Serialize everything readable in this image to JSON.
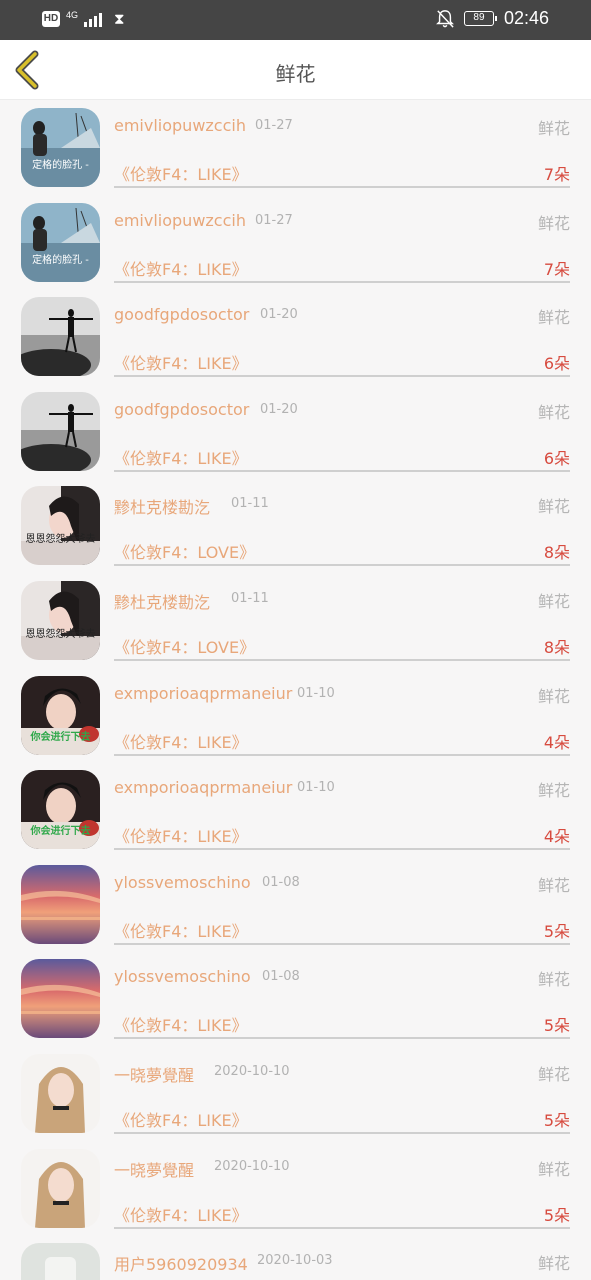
{
  "status_bar": {
    "hd": "HD",
    "network": "4G",
    "battery": "89",
    "time": "02:46"
  },
  "header": {
    "title": "鲜花"
  },
  "records": [
    {
      "user": "emivliopuwzccih",
      "date": "01-27",
      "kind": "鲜花",
      "song": "《伦敦F4：LIKE》",
      "count": "7朵",
      "avatar_caption": "定格的脸孔 -"
    },
    {
      "user": "emivliopuwzccih",
      "date": "01-27",
      "kind": "鲜花",
      "song": "《伦敦F4：LIKE》",
      "count": "7朵",
      "avatar_caption": "定格的脸孔 -"
    },
    {
      "user": "goodfgpdosoctor",
      "date": "01-20",
      "kind": "鲜花",
      "song": "《伦敦F4：LIKE》",
      "count": "6朵",
      "avatar_caption": ""
    },
    {
      "user": "goodfgpdosoctor",
      "date": "01-20",
      "kind": "鲜花",
      "song": "《伦敦F4：LIKE》",
      "count": "6朵",
      "avatar_caption": ""
    },
    {
      "user": "黪杜克楼勘汔",
      "date": "01-11",
      "kind": "鲜花",
      "song": "《伦敦F4：LOVE》",
      "count": "8朵",
      "avatar_caption": "恩恩怨怨大爷去"
    },
    {
      "user": "黪杜克楼勘汔",
      "date": "01-11",
      "kind": "鲜花",
      "song": "《伦敦F4：LOVE》",
      "count": "8朵",
      "avatar_caption": "恩恩怨怨大爷去"
    },
    {
      "user": "exmporioaqprmaneiur",
      "date": "01-10",
      "kind": "鲜花",
      "song": "《伦敦F4：LIKE》",
      "count": "4朵",
      "avatar_caption": "你会进行下去"
    },
    {
      "user": "exmporioaqprmaneiur",
      "date": "01-10",
      "kind": "鲜花",
      "song": "《伦敦F4：LIKE》",
      "count": "4朵",
      "avatar_caption": "你会进行下去"
    },
    {
      "user": "ylossvemoschino",
      "date": "01-08",
      "kind": "鲜花",
      "song": "《伦敦F4：LIKE》",
      "count": "5朵",
      "avatar_caption": ""
    },
    {
      "user": "ylossvemoschino",
      "date": "01-08",
      "kind": "鲜花",
      "song": "《伦敦F4：LIKE》",
      "count": "5朵",
      "avatar_caption": ""
    },
    {
      "user": "一晓夢覺醒",
      "date": "2020-10-10",
      "kind": "鲜花",
      "song": "《伦敦F4：LIKE》",
      "count": "5朵",
      "avatar_caption": ""
    },
    {
      "user": "一晓夢覺醒",
      "date": "2020-10-10",
      "kind": "鲜花",
      "song": "《伦敦F4：LIKE》",
      "count": "5朵",
      "avatar_caption": ""
    },
    {
      "user": "用户5960920934",
      "date": "2020-10-03",
      "kind": "鲜花",
      "song": "",
      "count": "",
      "avatar_caption": ""
    }
  ],
  "colors": {
    "accent": "#e8a77a",
    "count": "#d74b3f",
    "muted": "#b2b2b2",
    "back_icon": "#d8c02b"
  },
  "icons": {
    "back": "chevron-left-icon",
    "signal": "signal-bars-icon",
    "hourglass": "hourglass-icon",
    "bell_off": "bell-off-icon",
    "battery": "battery-icon"
  }
}
